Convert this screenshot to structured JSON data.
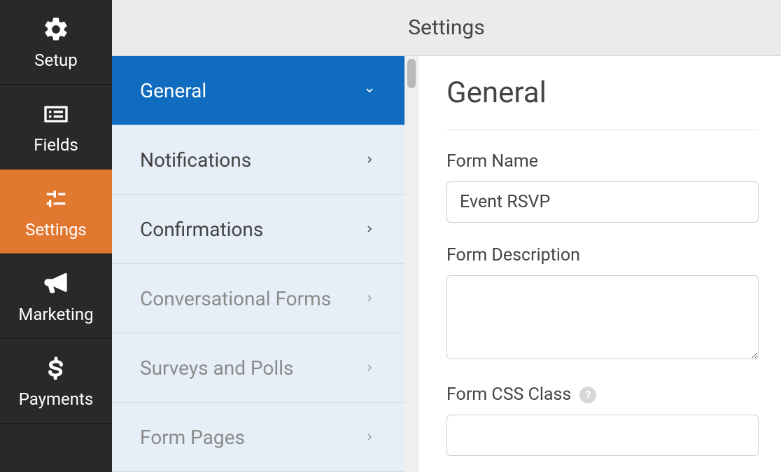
{
  "topbar": {
    "title": "Settings"
  },
  "rail": {
    "items": [
      {
        "id": "setup",
        "label": "Setup"
      },
      {
        "id": "fields",
        "label": "Fields"
      },
      {
        "id": "settings",
        "label": "Settings"
      },
      {
        "id": "marketing",
        "label": "Marketing"
      },
      {
        "id": "payments",
        "label": "Payments"
      }
    ],
    "active": "settings"
  },
  "subnav": {
    "items": [
      {
        "id": "general",
        "label": "General",
        "active": true,
        "muted": false
      },
      {
        "id": "notifications",
        "label": "Notifications",
        "active": false,
        "muted": false
      },
      {
        "id": "confirmations",
        "label": "Confirmations",
        "active": false,
        "muted": false
      },
      {
        "id": "conversational",
        "label": "Conversational Forms",
        "active": false,
        "muted": true
      },
      {
        "id": "surveys",
        "label": "Surveys and Polls",
        "active": false,
        "muted": true
      },
      {
        "id": "formpages",
        "label": "Form Pages",
        "active": false,
        "muted": true
      }
    ]
  },
  "panel": {
    "heading": "General",
    "form_name_label": "Form Name",
    "form_name_value": "Event RSVP",
    "form_description_label": "Form Description",
    "form_description_value": "",
    "form_css_label": "Form CSS Class",
    "form_css_value": ""
  }
}
